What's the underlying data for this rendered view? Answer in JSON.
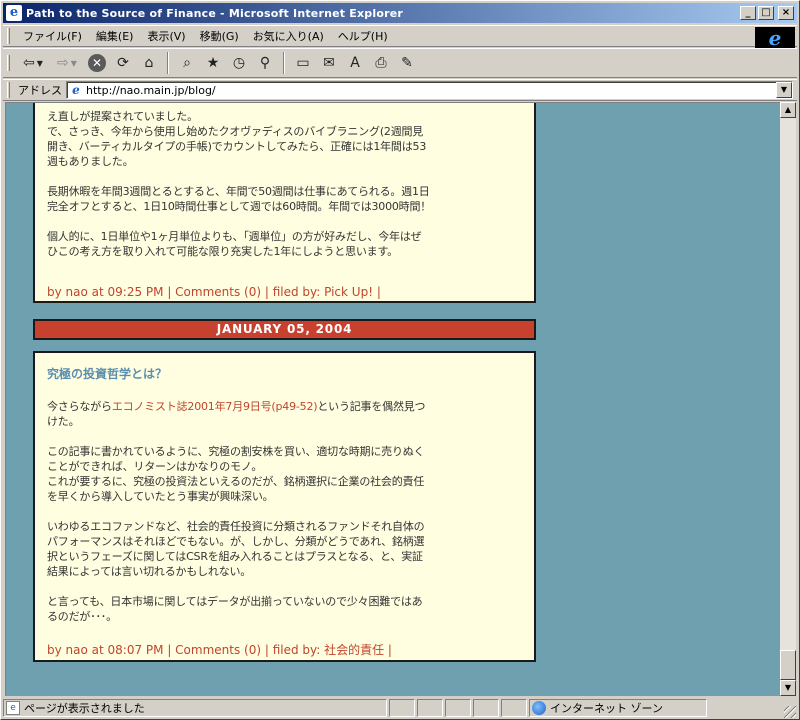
{
  "window": {
    "title": "Path to the Source of Finance - Microsoft Internet Explorer",
    "app_icon": "e",
    "controls": {
      "minimize": "_",
      "maximize": "□",
      "close": "×"
    }
  },
  "menubar": {
    "items": [
      "ファイル(F)",
      "編集(E)",
      "表示(V)",
      "移動(G)",
      "お気に入り(A)",
      "ヘルプ(H)"
    ]
  },
  "toolbar": {
    "icons": [
      "back-icon",
      "forward-icon",
      "stop-icon",
      "refresh-icon",
      "home-icon",
      "search-icon",
      "favorites-icon",
      "history-icon",
      "channels-icon",
      "fullscreen-icon",
      "mail-icon",
      "font-icon",
      "print-icon",
      "edit-icon"
    ],
    "font_glyph": "A"
  },
  "address": {
    "label": "アドレス",
    "url": "http://nao.main.jp/blog/"
  },
  "posts": [
    {
      "paragraphs": [
        "え直しが提案されていました。\nで、さっき、今年から使用し始めたクオヴァディスのバイブラニング(2週間見開き、バーティカルタイプの手帳)でカウントしてみたら、正確には1年間は53週もありました。",
        "長期休暇を年間3週間とるとすると、年間で50週間は仕事にあてられる。週1日完全オフとすると、1日10時間仕事として週では60時間。年間では3000時間！",
        "個人的に、1日単位や1ヶ月単位よりも、「週単位」の方が好みだし、今年はぜひこの考え方を取り入れて可能な限り充実した1年にしようと思います。"
      ],
      "footer": "by nao at 09:25 PM | Comments (0) | filed by: Pick Up! |"
    },
    {
      "date": "JANUARY 05, 2004",
      "title": "究極の投資哲学とは？",
      "intro_prefix": "今さらながら",
      "intro_link": "エコノミスト誌2001年7月9日号(p49-52)",
      "intro_suffix": "という記事を偶然見つけた。",
      "paragraphs": [
        "この記事に書かれているように、究極の割安株を買い、適切な時期に売りぬくことができれば、リターンはかなりのモノ。\nこれが要するに、究極の投資法といえるのだが、銘柄選択に企業の社会的責任を早くから導入していたとう事実が興味深い。",
        "いわゆるエコファンドなど、社会的責任投資に分類されるファンドそれ自体のパフォーマンスはそれほどでもない。が、しかし、分類がどうであれ、銘柄選択というフェーズに関してはCSRを組み入れることはプラスとなる、と、実証結果によっては言い切れるかもしれない。",
        "と言っても、日本市場に関してはデータが出揃っていないので少々困難ではあるのだが･･･。"
      ],
      "footer": "by nao at 08:07 PM | Comments (0) | filed by: 社会的責任 |"
    }
  ],
  "status": {
    "text": "ページが表示されました",
    "zone": "インターネット ゾーン"
  },
  "colors": {
    "page_bg": "#6fa0b0",
    "post_bg": "#fffee0",
    "date_header_bg": "#c8402e",
    "link": "#c1442c",
    "title": "#5b8fb0"
  }
}
